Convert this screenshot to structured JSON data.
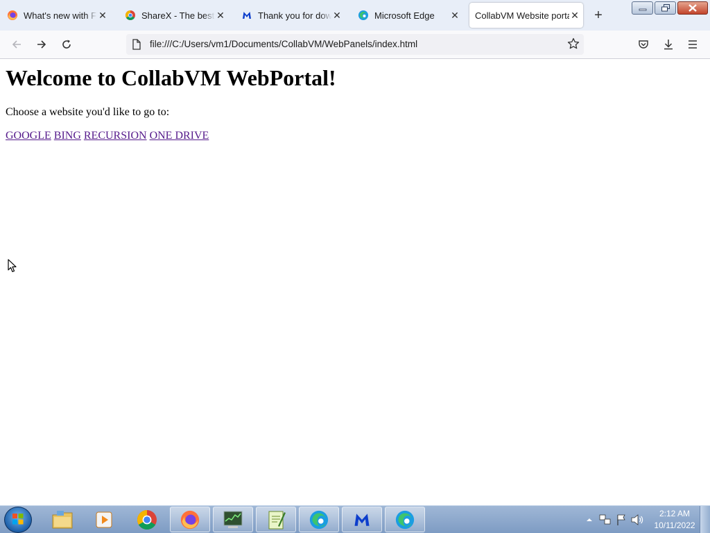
{
  "browser": {
    "tabs": [
      {
        "title": "What's new with Firefox",
        "icon": "firefox-icon",
        "active": false
      },
      {
        "title": "ShareX - The best free",
        "icon": "chrome-icon",
        "active": false
      },
      {
        "title": "Thank you for downloading",
        "icon": "malwarebytes-icon",
        "active": false
      },
      {
        "title": "Microsoft Edge",
        "icon": "edge-icon",
        "active": false
      },
      {
        "title": "CollabVM Website portal",
        "icon": "none",
        "active": true
      }
    ],
    "url": "file:///C:/Users/vm1/Documents/CollabVM/WebPanels/index.html"
  },
  "page": {
    "heading": "Welcome to CollabVM WebPortal!",
    "prompt": "Choose a website you'd like to go to:",
    "links": [
      "GOOGLE",
      "BING",
      "RECURSION",
      "ONE DRIVE"
    ],
    "link_color": "#551a8b"
  },
  "taskbar": {
    "pinned": [
      "file-explorer-icon",
      "media-player-icon",
      "chrome-icon",
      "firefox-icon",
      "task-manager-icon",
      "notepad-icon",
      "edge-icon",
      "malwarebytes-icon",
      "edge-icon"
    ],
    "clock": {
      "time": "2:12 AM",
      "date": "10/11/2022"
    }
  }
}
